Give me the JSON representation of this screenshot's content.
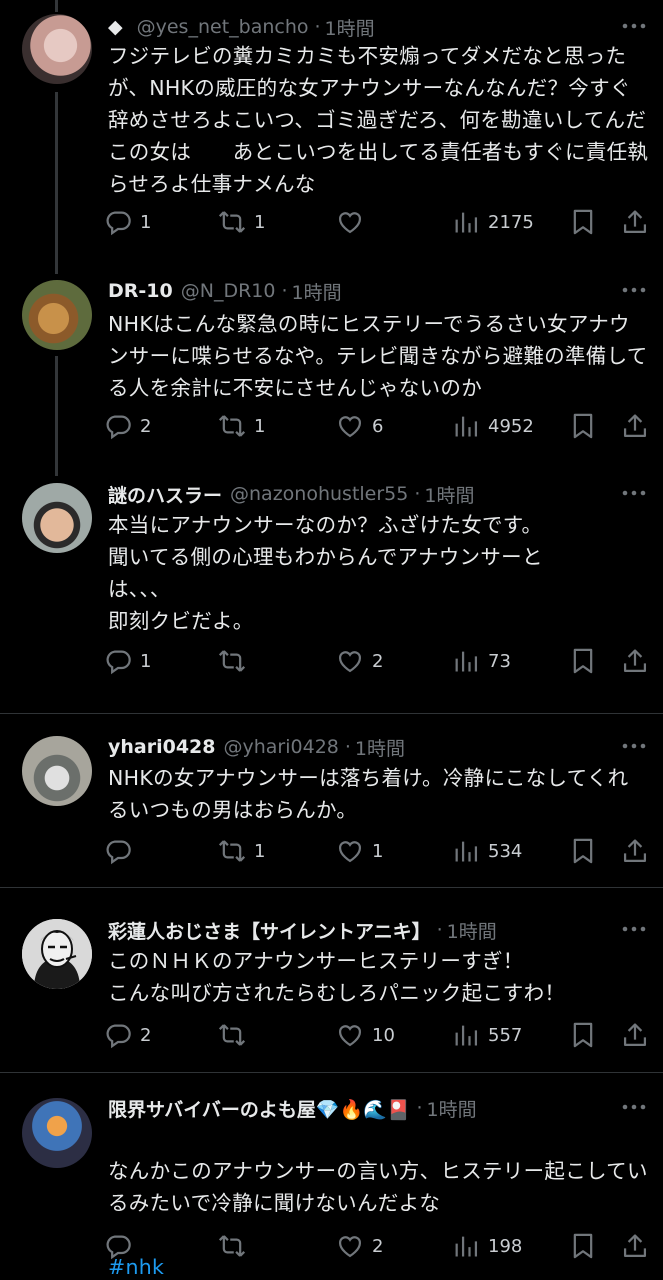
{
  "tweets": [
    {
      "badge": "◆",
      "display_name": "",
      "handle": "@yes_net_bancho",
      "dot": "·",
      "time": "1時間",
      "body": "フジテレビの糞カミカミも不安煽ってダメだなと思ったが、NHKの威圧的な女アナウンサーなんなんだ？今すぐ辞めさせろよこいつ、ゴミ過ぎだろ、何を勘違いしてんだこの女は　　あとこいつを出してる責任者もすぐに責任執らせろよ仕事ナメんな",
      "replies": "1",
      "retweets": "1",
      "likes": "",
      "views": "2175"
    },
    {
      "display_name": "DR-10",
      "handle": "@N_DR10",
      "dot": "·",
      "time": "1時間",
      "body": "NHKはこんな緊急の時にヒステリーでうるさい女アナウンサーに喋らせるなや。テレビ聞きながら避難の準備してる人を余計に不安にさせんじゃないのか",
      "replies": "2",
      "retweets": "1",
      "likes": "6",
      "views": "4952"
    },
    {
      "display_name": "謎のハスラー",
      "handle": "@nazonohustler55",
      "dot": "·",
      "time": "1時間",
      "body": "本当にアナウンサーなのか？ふざけた女です。\n聞いてる側の心理もわからんでアナウンサーとは、、、\n即刻クビだよ。",
      "replies": "1",
      "retweets": "",
      "likes": "2",
      "views": "73"
    },
    {
      "display_name": "yhari0428",
      "handle": "@yhari0428",
      "dot": "·",
      "time": "1時間",
      "body": "NHKの女アナウンサーは落ち着け。冷静にこなしてくれるいつもの男はおらんか。",
      "replies": "",
      "retweets": "1",
      "likes": "1",
      "views": "534"
    },
    {
      "display_name": "彩蓮人おじさま【サイレントアニキ】",
      "handle": "",
      "dot": "·",
      "time": "1時間",
      "body": "このＮＨＫのアナウンサーヒステリーすぎ！\nこんな叫び方されたらむしろパニック起こすわ！",
      "replies": "2",
      "retweets": "",
      "likes": "10",
      "views": "557"
    },
    {
      "display_name": "限界サバイバーのよも屋💎🔥🌊🎴",
      "handle": "",
      "dot": "·",
      "time": "1時間",
      "body": "なんかこのアナウンサーの言い方、ヒステリー起こしているみたいで冷静に聞けないんだよな",
      "hashtag": "#nhk",
      "replies": "",
      "retweets": "",
      "likes": "2",
      "views": "198"
    }
  ],
  "icons": {
    "reply": "reply-icon",
    "retweet": "retweet-icon",
    "like": "like-icon",
    "views": "views-icon",
    "bookmark": "bookmark-icon",
    "share": "share-icon",
    "more": "more-icon"
  },
  "colors": {
    "background": "#000000",
    "text": "#e7e9ea",
    "secondary": "#71767b",
    "link": "#1d9bf0",
    "divider": "#2f3336"
  }
}
